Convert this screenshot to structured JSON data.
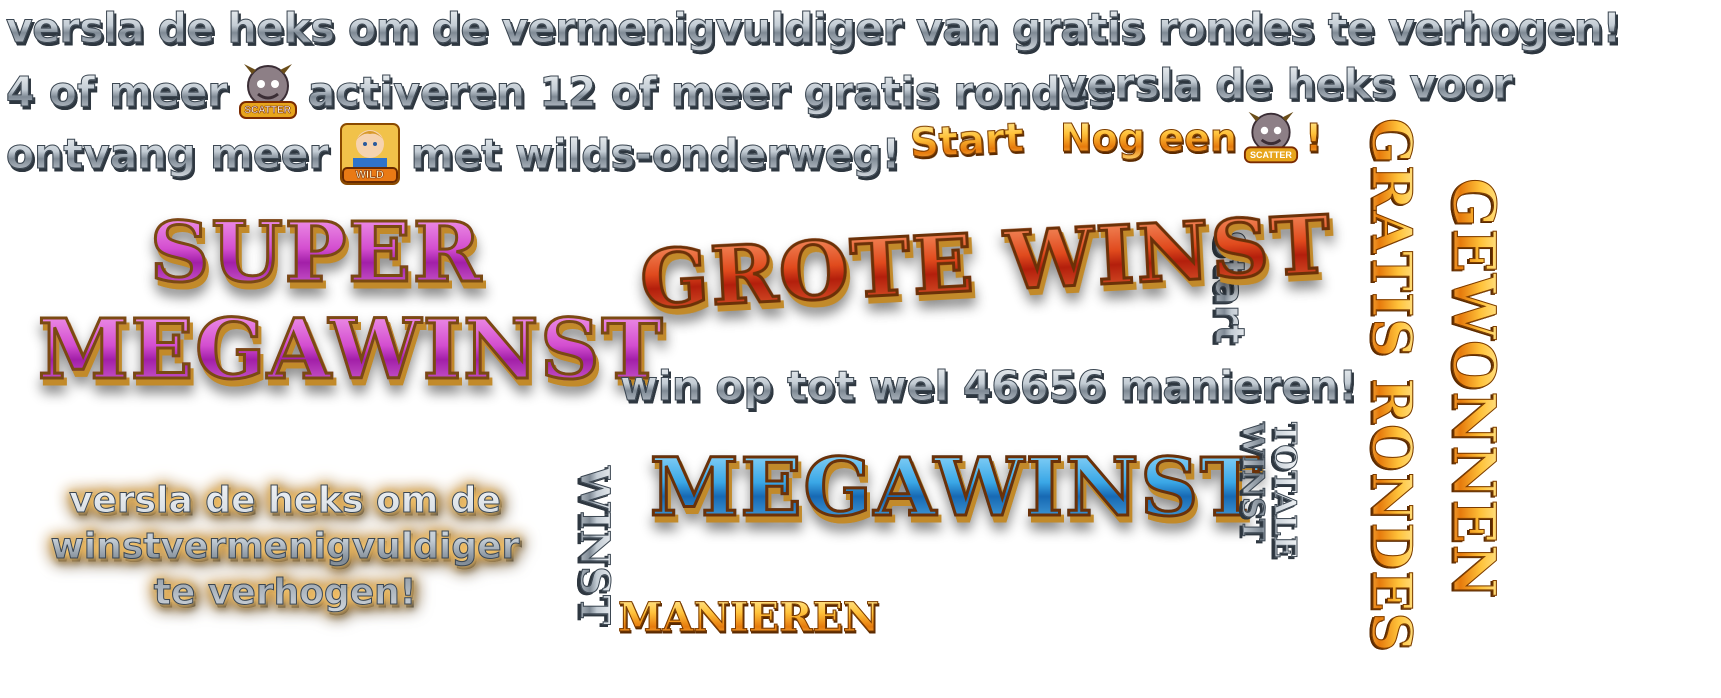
{
  "lines": {
    "line1": "versla de heks om de vermenigvuldiger van gratis rondes te verhogen!",
    "line2_pre": "4 of meer",
    "line2_post": "activeren 12 of meer gratis rondes",
    "line2b": "versla de heks voor",
    "line3_pre": "ontvang meer",
    "line3_post": "met wilds-onderweg!",
    "start_gold": "Start",
    "nog_een": "Nog een",
    "nog_een_end": "!",
    "start_vertical": "Start",
    "win_ways": "win op tot wel 46656 manieren!",
    "multiplier_note": [
      "versla de heks om de",
      "winstvermenigvuldiger",
      "te verhogen!"
    ],
    "winst_vertical": "WINST",
    "manieren": "MANIEREN",
    "totale_winst": [
      "TOTALE",
      "WINST"
    ],
    "gratis_rondes": "GRATIS RONDES",
    "gewonnen": "GEWONNEN"
  },
  "banners": {
    "super_megawinst": [
      "SUPER",
      "MEGAWINST"
    ],
    "grote_winst": "GROTE WINST",
    "megawinst": "MEGAWINST"
  },
  "symbols": {
    "scatter_label": "SCATTER",
    "wild_label": "WILD",
    "scatter_icon": "scatter-icon",
    "wild_icon": "wild-icon"
  },
  "colors": {
    "silver": "#c3ccd4",
    "gold": "#ffc23a",
    "pink": "#d44fd0",
    "red": "#e04a1d",
    "blue": "#3aa7e6"
  }
}
